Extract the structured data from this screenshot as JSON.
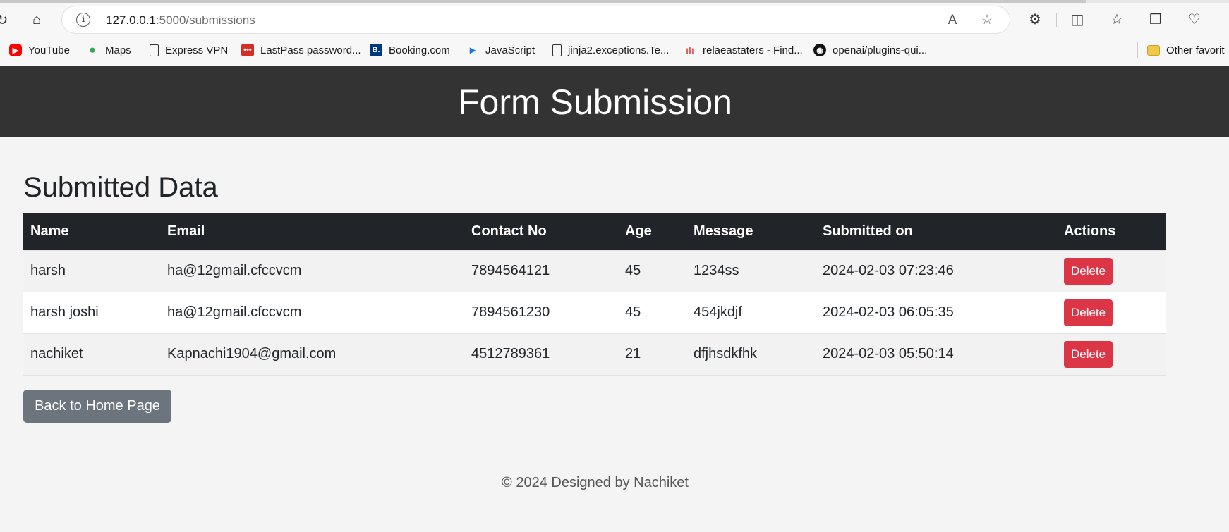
{
  "browser": {
    "url_host": "127.0.0.1",
    "url_path": ":5000/submissions",
    "bookmarks": [
      {
        "label": "YouTube",
        "icon": "youtube-icon",
        "color": "#ff0000"
      },
      {
        "label": "Maps",
        "icon": "maps-pin-icon",
        "color": "#34a853"
      },
      {
        "label": "Express VPN",
        "icon": "page-icon",
        "color": "#ffffff"
      },
      {
        "label": "LastPass password...",
        "icon": "lastpass-icon",
        "color": "#d32d27"
      },
      {
        "label": "Booking.com",
        "icon": "booking-icon",
        "color": "#003580"
      },
      {
        "label": "JavaScript",
        "icon": "javascript-icon",
        "color": "#1a73e8"
      },
      {
        "label": "jinja2.exceptions.Te...",
        "icon": "page-icon",
        "color": "#ffffff"
      },
      {
        "label": "relaeastaters - Find...",
        "icon": "chart-icon",
        "color": "#e35d5b"
      },
      {
        "label": "openai/plugins-qui...",
        "icon": "github-icon",
        "color": "#000000"
      },
      {
        "label": "Other favorit",
        "icon": "folder-icon",
        "color": "#f2c84b"
      }
    ]
  },
  "header": {
    "title": "Form Submission"
  },
  "main": {
    "section_title": "Submitted Data",
    "columns": [
      "Name",
      "Email",
      "Contact No",
      "Age",
      "Message",
      "Submitted on",
      "Actions"
    ],
    "rows": [
      {
        "name": "harsh",
        "email": "ha@12gmail.cfccvcm",
        "contact": "7894564121",
        "age": "45",
        "message": "1234ss",
        "submitted_on": "2024-02-03 07:23:46"
      },
      {
        "name": "harsh joshi",
        "email": "ha@12gmail.cfccvcm",
        "contact": "7894561230",
        "age": "45",
        "message": "454jkdjf",
        "submitted_on": "2024-02-03 06:05:35"
      },
      {
        "name": "nachiket",
        "email": "Kapnachi1904@gmail.com",
        "contact": "4512789361",
        "age": "21",
        "message": "dfjhsdkfhk",
        "submitted_on": "2024-02-03 05:50:14"
      }
    ],
    "delete_label": "Delete",
    "back_label": "Back to Home Page"
  },
  "footer": {
    "text": "© 2024 Designed by Nachiket"
  },
  "colors": {
    "header_bg": "#333333",
    "table_head_bg": "#212529",
    "delete_bg": "#dc3545",
    "back_bg": "#6c757d"
  }
}
